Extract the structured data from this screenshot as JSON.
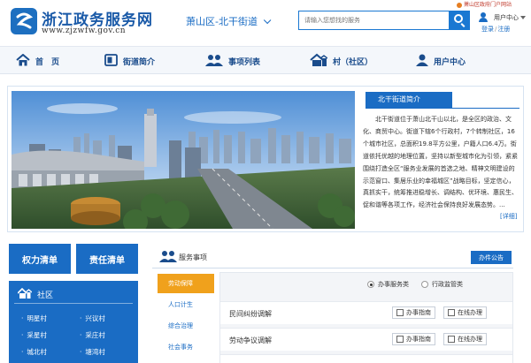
{
  "header": {
    "site_title": "浙江政务服务网",
    "site_url": "www.zjzwfw.gov.cn",
    "region": "萧山区-北干街道",
    "search_placeholder": "请输入您想找的服务",
    "top_link": "萧山区政府门户网站",
    "user_center": "用户中心",
    "login": "登录",
    "register": "注册",
    "login_sep": "/"
  },
  "nav": {
    "items": [
      {
        "label": "首　页",
        "icon": "home-icon"
      },
      {
        "label": "街道简介",
        "icon": "book-icon"
      },
      {
        "label": "事项列表",
        "icon": "people-icon"
      },
      {
        "label": "村（社区）",
        "icon": "village-house-icon"
      },
      {
        "label": "用户中心",
        "icon": "user-icon"
      }
    ]
  },
  "intro": {
    "tab_label": "北干街道简介",
    "text": "北干街道位于萧山北干山以北，是全区的政治、文化、商贸中心。街道下辖6个行政村，7个转制社区，16个城市社区，总面积19.8平方公里，户籍人口6.4万。街道依托优越的地理位置，坚持以新型城市化为引领，紧紧围绕打造全区“服务业发展的首选之地、精神文明建设的示范窗口、集居乐业的幸福城区”战略目标，坚定信心，真抓实干，统筹推进稳增长、调结构、优环境、惠民生、促和谐等各项工作，经济社会保持良好发展态势。...",
    "more": "[详细]"
  },
  "left": {
    "btn_quan": "权力清单",
    "btn_zeren": "责任清单",
    "shequ_title": "社区",
    "villages": [
      "明星村",
      "兴议村",
      "采星村",
      "采庄村",
      "城北村",
      "塘湾村"
    ]
  },
  "service": {
    "title": "服务事项",
    "notice_btn": "办件公告",
    "categories": [
      "劳动保障",
      "人口计生",
      "综合治理",
      "社会事务"
    ],
    "radio_options": [
      "办事服务类",
      "行政监管类"
    ],
    "items": [
      {
        "name": "民间纠纷调解",
        "guide": "办事指南",
        "online": "在线办理"
      },
      {
        "name": "劳动争议调解",
        "guide": "办事指南",
        "online": "在线办理"
      }
    ]
  },
  "colors": {
    "brand_blue": "#1a6cc4",
    "active_orange": "#f0a11c",
    "nav_bg": "#f4f7fb"
  }
}
